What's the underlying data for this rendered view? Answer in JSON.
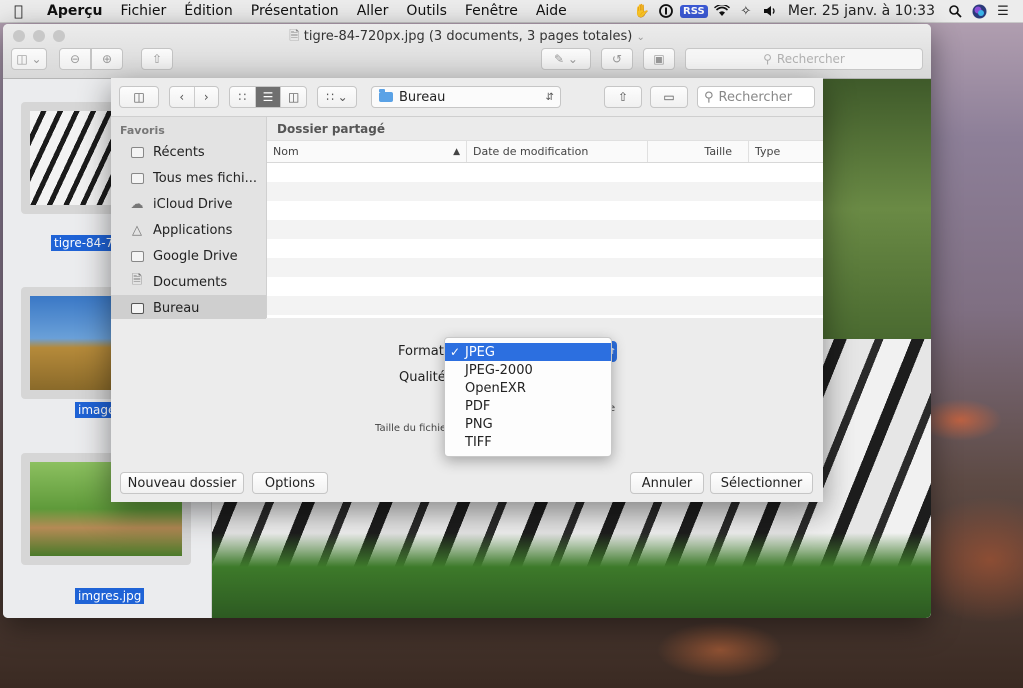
{
  "menubar": {
    "app": "Aperçu",
    "menus": [
      "Fichier",
      "Édition",
      "Présentation",
      "Aller",
      "Outils",
      "Fenêtre",
      "Aide"
    ],
    "rss": "RSS",
    "clock": "Mer. 25 janv. à  10:33"
  },
  "window": {
    "title": "tigre-84-720px.jpg (3 documents, 3 pages totales)",
    "search_placeholder": "Rechercher"
  },
  "thumbnails": [
    {
      "label": "tigre-84-7"
    },
    {
      "label": "images"
    },
    {
      "label": "imgres.jpg"
    }
  ],
  "dialog": {
    "location": "Bureau",
    "search_placeholder": "Rechercher",
    "sidebar_header": "Favoris",
    "sidebar_items": [
      {
        "label": "Récents",
        "icon": "recents-icon"
      },
      {
        "label": "Tous mes fichi...",
        "icon": "all-files-icon"
      },
      {
        "label": "iCloud Drive",
        "icon": "icloud-icon"
      },
      {
        "label": "Applications",
        "icon": "applications-icon"
      },
      {
        "label": "Google Drive",
        "icon": "folder-icon"
      },
      {
        "label": "Documents",
        "icon": "documents-icon"
      },
      {
        "label": "Bureau",
        "icon": "desktop-icon"
      }
    ],
    "shared_folder": "Dossier partagé",
    "columns": [
      "Nom",
      "Date de modification",
      "Taille",
      "Type"
    ],
    "format_label": "Format",
    "quality_label": "Qualité",
    "filesize_label": "Taille du fichier",
    "quality_tail": "e",
    "format_options": [
      "JPEG",
      "JPEG-2000",
      "OpenEXR",
      "PDF",
      "PNG",
      "TIFF"
    ],
    "selected_format": "JPEG",
    "buttons": {
      "new_folder": "Nouveau dossier",
      "options": "Options",
      "cancel": "Annuler",
      "select": "Sélectionner"
    }
  },
  "colors": {
    "accent": "#2c6fe0",
    "close": "#fd5f57",
    "minimize": "#fdbc2e",
    "zoom": "#28c840"
  }
}
